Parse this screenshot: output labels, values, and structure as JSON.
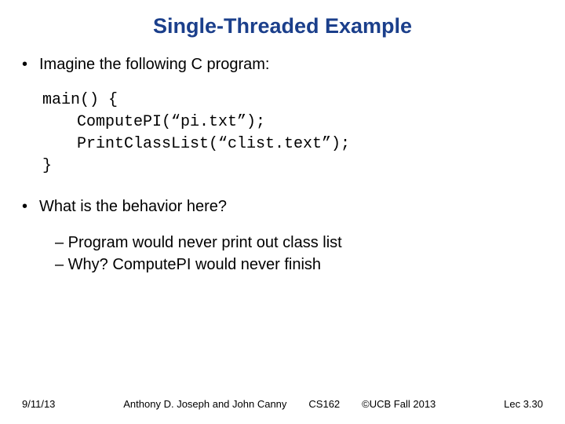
{
  "title": "Single-Threaded Example",
  "bullet1": "Imagine the following C program:",
  "code": {
    "l1": "main() {",
    "l2": "ComputePI(“pi.txt”);",
    "l3": "PrintClassList(“clist.text”);",
    "l4": "}"
  },
  "bullet2": "What is the behavior here?",
  "sub1": "– Program would never print out class list",
  "sub2": "– Why? ComputePI would never finish",
  "footer": {
    "date": "9/11/13",
    "authors": "Anthony D. Joseph and John Canny",
    "course": "CS162",
    "copyright": "©UCB Fall 2013",
    "lec": "Lec 3.30"
  }
}
